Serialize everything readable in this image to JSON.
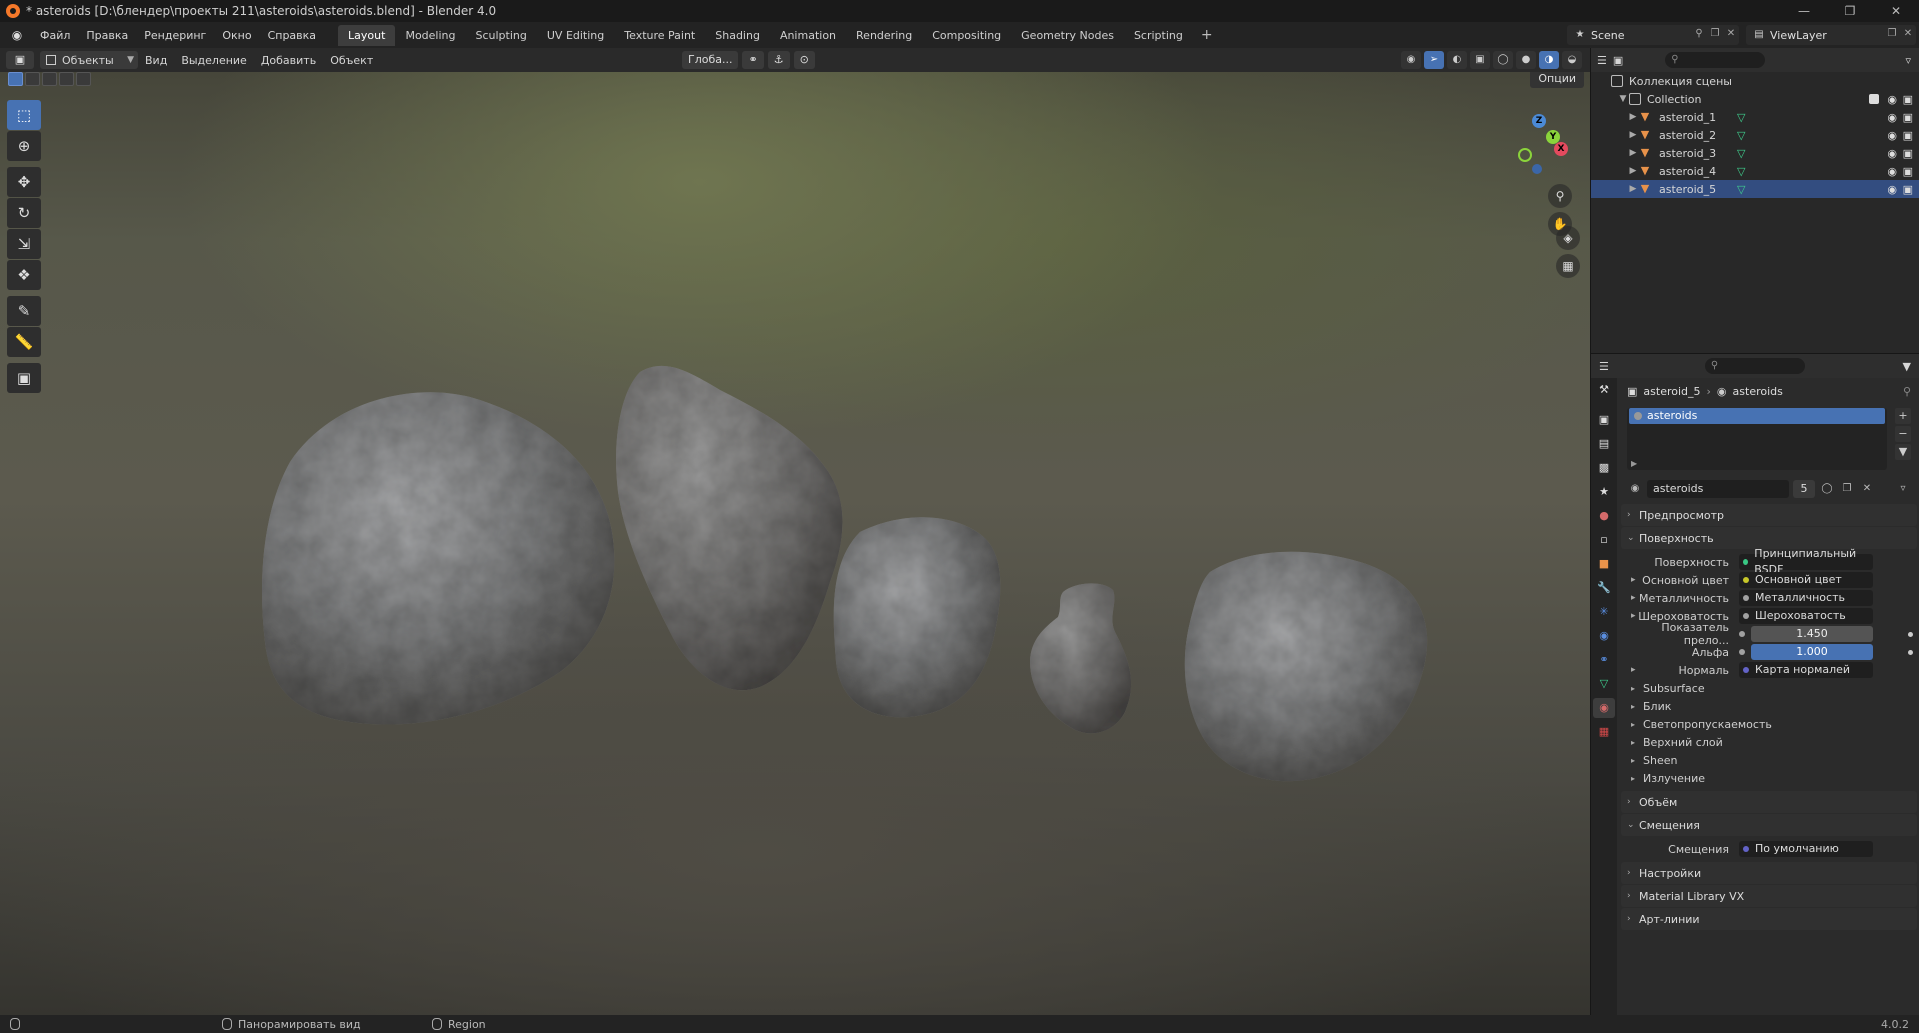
{
  "window": {
    "title": "* asteroids [D:\\блендер\\проекты 211\\asteroids\\asteroids.blend] - Blender 4.0"
  },
  "menu": [
    "Файл",
    "Правка",
    "Рендеринг",
    "Окно",
    "Справка"
  ],
  "workspaces": {
    "tabs": [
      "Layout",
      "Modeling",
      "Sculpting",
      "UV Editing",
      "Texture Paint",
      "Shading",
      "Animation",
      "Rendering",
      "Compositing",
      "Geometry Nodes",
      "Scripting"
    ],
    "active": "Layout",
    "add_label": "+"
  },
  "scene": {
    "name": "Scene"
  },
  "view_layer": {
    "name": "ViewLayer"
  },
  "viewport_header": {
    "mode": "Объекты",
    "menus": [
      "Вид",
      "Выделение",
      "Добавить",
      "Объект"
    ],
    "transform_orientation": "Глоба...",
    "options_label": "Опции"
  },
  "gizmo": {
    "x": "X",
    "y": "Y",
    "z": "Z"
  },
  "outliner": {
    "search_placeholder": "",
    "scene_collection": "Коллекция сцены",
    "collection": "Collection",
    "objects": [
      {
        "name": "asteroid_1",
        "selected": false
      },
      {
        "name": "asteroid_2",
        "selected": false
      },
      {
        "name": "asteroid_3",
        "selected": false
      },
      {
        "name": "asteroid_4",
        "selected": false
      },
      {
        "name": "asteroid_5",
        "selected": true
      }
    ]
  },
  "properties": {
    "breadcrumb": {
      "object": "asteroid_5",
      "material": "asteroids"
    },
    "material_slots": [
      "asteroids"
    ],
    "material": {
      "name": "asteroids",
      "users": "5"
    },
    "panels": {
      "preview": "Предпросмотр",
      "surface": "Поверхность",
      "volume": "Объём",
      "displacement": "Смещения",
      "settings": "Настройки",
      "material_library": "Material Library VX",
      "line_art": "Арт-линии"
    },
    "surface_rows": [
      {
        "label": "Поверхность",
        "value": "Принципиальный BSDF",
        "kind": "field",
        "color": "#39c884"
      },
      {
        "label": "Основной цвет",
        "value": "Основной цвет",
        "kind": "field",
        "color": "#c7c729",
        "expand": true
      },
      {
        "label": "Металличность",
        "value": "Металличность",
        "kind": "field",
        "color": "#a1a1a1",
        "expand": true
      },
      {
        "label": "Шероховатость",
        "value": "Шероховатость",
        "kind": "field",
        "color": "#a1a1a1",
        "expand": true
      },
      {
        "label": "Показатель прело...",
        "value": "1.450",
        "kind": "num",
        "color": "#a1a1a1"
      },
      {
        "label": "Альфа",
        "value": "1.000",
        "kind": "num-blue",
        "color": "#a1a1a1"
      },
      {
        "label": "Нормаль",
        "value": "Карта нормалей",
        "kind": "field",
        "color": "#6363c7",
        "expand": true
      }
    ],
    "surface_subpanels": [
      "Subsurface",
      "Блик",
      "Светопропускаемость",
      "Верхний слой",
      "Sheen",
      "Излучение"
    ],
    "displacement_row": {
      "label": "Смещения",
      "value": "По умолчанию",
      "color": "#6363c7"
    }
  },
  "statusbar": {
    "hint1": "Панорамировать вид",
    "hint2": "Region",
    "version": "4.0.2"
  },
  "colors": {
    "accent": "#4772b3",
    "object_icon": "#e8924a",
    "mesh_icon": "#3fcf8e"
  }
}
